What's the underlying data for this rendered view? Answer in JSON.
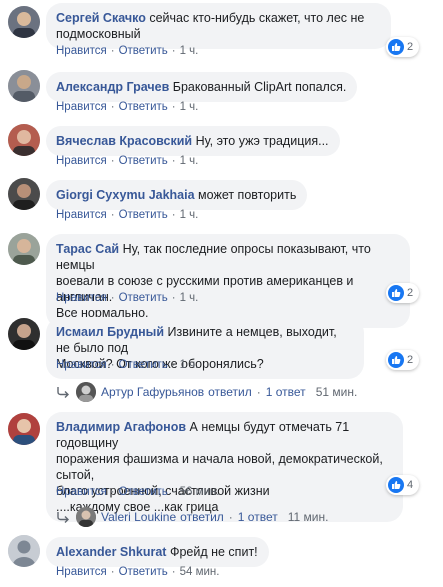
{
  "comments": [
    {
      "author": "Сергей Скачко",
      "text": "сейчас кто-нибудь скажет, что лес не подмосковный",
      "like": "Нравится",
      "reply": "Ответить",
      "time": "1 ч.",
      "reactions": "2"
    },
    {
      "author": "Александр Грачев",
      "text": "Бракованный ClipArt попался.",
      "like": "Нравится",
      "reply": "Ответить",
      "time": "1 ч."
    },
    {
      "author": "Вячеслав Красовский",
      "text": "Ну, это ужэ традиция...",
      "like": "Нравится",
      "reply": "Ответить",
      "time": "1 ч."
    },
    {
      "author": "Giorgi Сухуmu Jakhaia",
      "text": "может повторить",
      "like": "Нравится",
      "reply": "Ответить",
      "time": "1 ч."
    },
    {
      "author": "Тарас Сай",
      "text_lines": [
        "Ну, так последние опросы показывают, что немцы",
        "воевали в союзе с русскими против американцев и англичан.",
        "Все нормально."
      ],
      "like": "Нравится",
      "reply": "Ответить",
      "time": "1 ч.",
      "reactions": "2"
    },
    {
      "author": "Исмаил Брудный",
      "text_lines": [
        "Извините а немцев, выходит, не было под",
        "Москвой? От кого же оборонялись?"
      ],
      "like": "Нравится",
      "reply": "Ответить",
      "time": "1 ч.",
      "reactions": "2",
      "reply_summary": {
        "name": "Артур Гафурьянов",
        "verb": "ответил",
        "count": "1 ответ",
        "time": "51 мин."
      }
    },
    {
      "author": "Владимир Агафонов",
      "text_lines": [
        "А немцы будут отмечать 71 годовщину",
        "поражения фашизма и начала новой, демократической, сытой,",
        "благо устроенной, счастливой жизни",
        "....каждому свое ...как грица"
      ],
      "like": "Нравится",
      "reply": "Ответить",
      "time": "56 мин.",
      "reactions": "4",
      "reply_summary": {
        "name": "Valeri Loukine",
        "verb": "ответил",
        "count": "1 ответ",
        "time": "11 мин."
      }
    },
    {
      "author": "Alexander Shkurat",
      "text": "Фрейд не спит!",
      "like": "Нравится",
      "reply": "Ответить",
      "time": "54 мин."
    }
  ],
  "colors": {
    "author": "#385898",
    "bubble": "#f2f3f5",
    "meta": "#606770",
    "like": "#1877f2"
  }
}
